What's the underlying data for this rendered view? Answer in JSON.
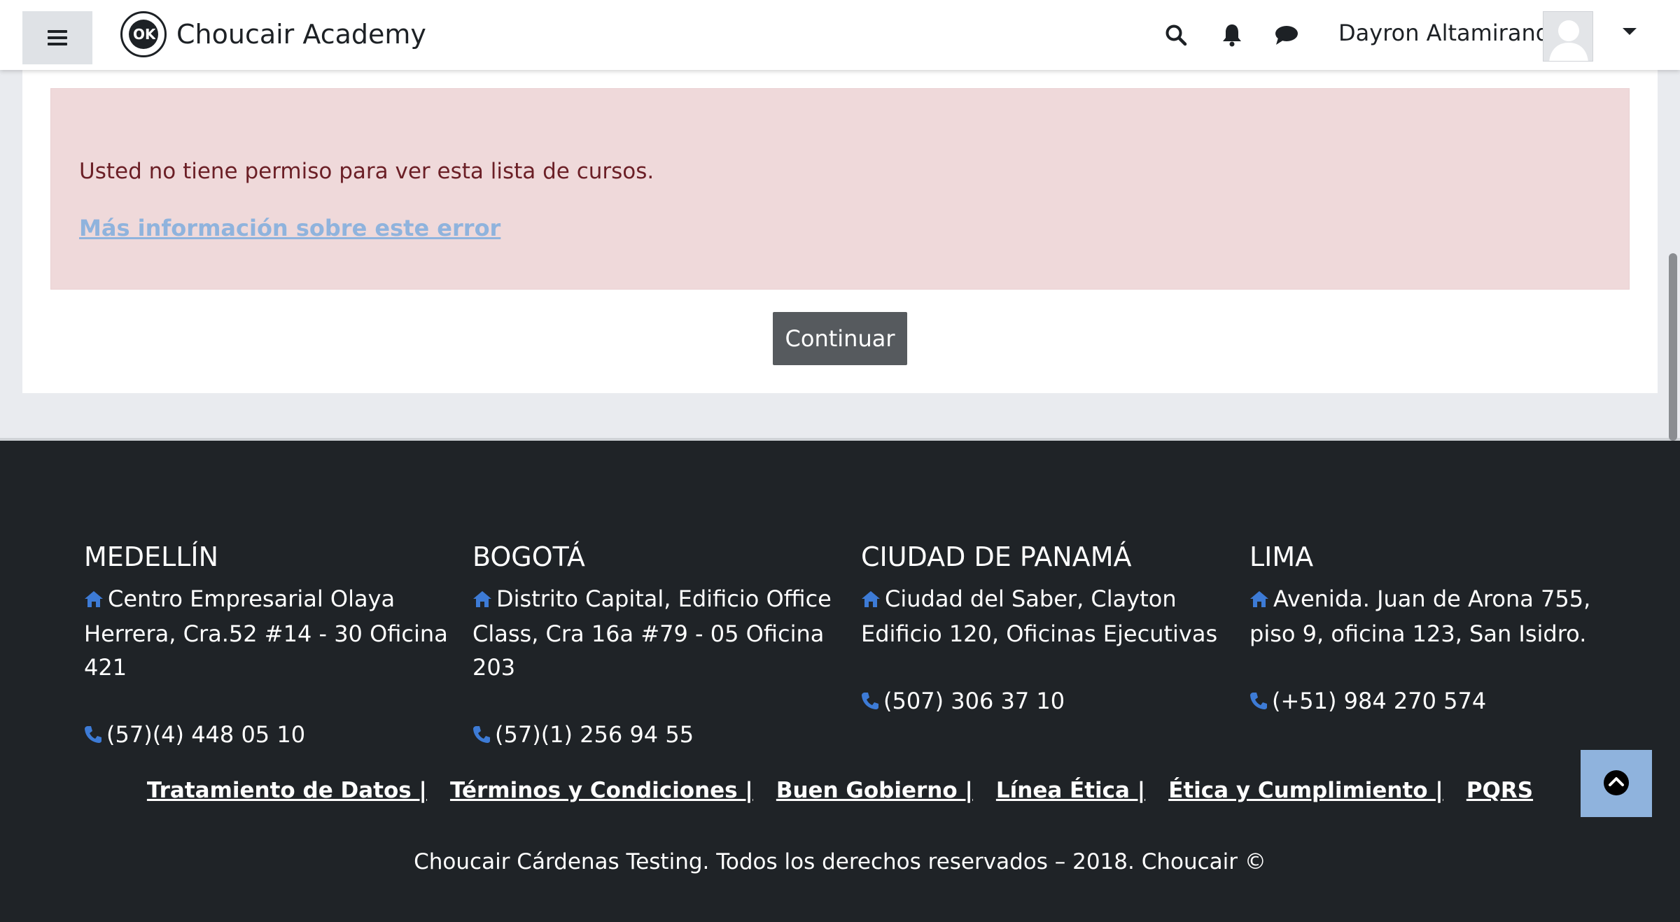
{
  "navbar": {
    "brand_name": "Choucair Academy",
    "user_name": "Dayron Altamiranda",
    "icons": [
      "hamburger-icon",
      "search-icon",
      "bell-icon",
      "chat-icon",
      "caret-down-icon"
    ]
  },
  "alert": {
    "message": "Usted no tiene permiso para ver esta lista de cursos.",
    "more_info_link": "Más información sobre este error"
  },
  "actions": {
    "continue_label": "Continuar"
  },
  "footer": {
    "offices": [
      {
        "city": "MEDELLÍN",
        "address": "Centro Empresarial Olaya Herrera, Cra.52 #14 - 30 Oficina 421",
        "phone": "(57)(4) 448 05 10"
      },
      {
        "city": "BOGOTÁ",
        "address": "Distrito Capital, Edificio Office Class, Cra 16a #79 - 05 Oficina 203",
        "phone": "(57)(1) 256 94 55"
      },
      {
        "city": "CIUDAD DE PANAMÁ",
        "address": "Ciudad del Saber, Clayton Edificio 120, Oficinas Ejecutivas",
        "phone": "(507) 306 37 10"
      },
      {
        "city": "LIMA",
        "address": "Avenida. Juan de Arona 755, piso 9, oficina 123, San Isidro.",
        "phone": "(+51) 984 270 574"
      }
    ],
    "links": [
      "Tratamiento de Datos |",
      "Términos y Condiciones |",
      "Buen Gobierno |",
      "Línea Ética |",
      "Ética y Cumplimiento |",
      "PQRS"
    ],
    "copyright": "Choucair Cárdenas Testing. Todos los derechos reservados – 2018. Choucair ©"
  },
  "colors": {
    "alert_bg": "#efd9da",
    "alert_text": "#6b1f26",
    "link": "#8fb3dd",
    "footer_bg": "#1f2327",
    "icon_blue": "#3d7bd6",
    "button_bg": "#565a5e"
  }
}
